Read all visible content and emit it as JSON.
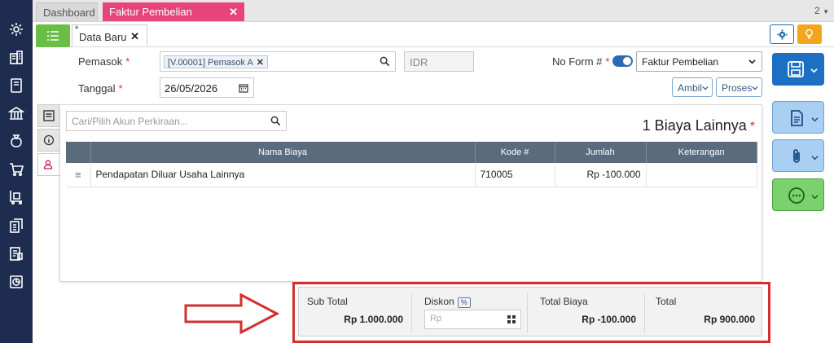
{
  "tabs": {
    "dashboard": "Dashboard",
    "active": "Faktur Pembelian",
    "count": "2"
  },
  "doc_tab": {
    "marker": "*",
    "label": "Data Baru"
  },
  "form": {
    "pemasok_label": "Pemasok",
    "required_mark": "*",
    "pemasok_value": "[V.00001] Pemasok A",
    "currency": "IDR",
    "noform_label": "No Form #",
    "form_type": "Faktur Pembelian",
    "tanggal_label": "Tanggal",
    "tanggal_value": "26/05/2026",
    "ambil_label": "Ambil",
    "proses_label": "Proses"
  },
  "panel": {
    "search_placeholder": "Cari/Pilih Akun Perkiraan...",
    "count_label": "1 Biaya Lainnya",
    "columns": [
      "Nama Biaya",
      "Kode #",
      "Jumlah",
      "Keterangan"
    ],
    "rows": [
      {
        "nama": "Pendapatan Diluar Usaha Lainnya",
        "kode": "710005",
        "jumlah": "Rp -100.000",
        "keterangan": ""
      }
    ]
  },
  "totals": {
    "subtotal_label": "Sub Total",
    "subtotal_value": "Rp 1.000.000",
    "diskon_label": "Diskon",
    "diskon_pct": "%",
    "diskon_placeholder": "Rp",
    "biaya_label": "Total Biaya",
    "biaya_value": "Rp -100.000",
    "total_label": "Total",
    "total_value": "Rp 900.000"
  },
  "colors": {
    "accent": "#e6447a",
    "nav": "#1e2d4f",
    "primary": "#1d6fc4",
    "green": "#6abd45",
    "highlight": "#d32f2f"
  }
}
